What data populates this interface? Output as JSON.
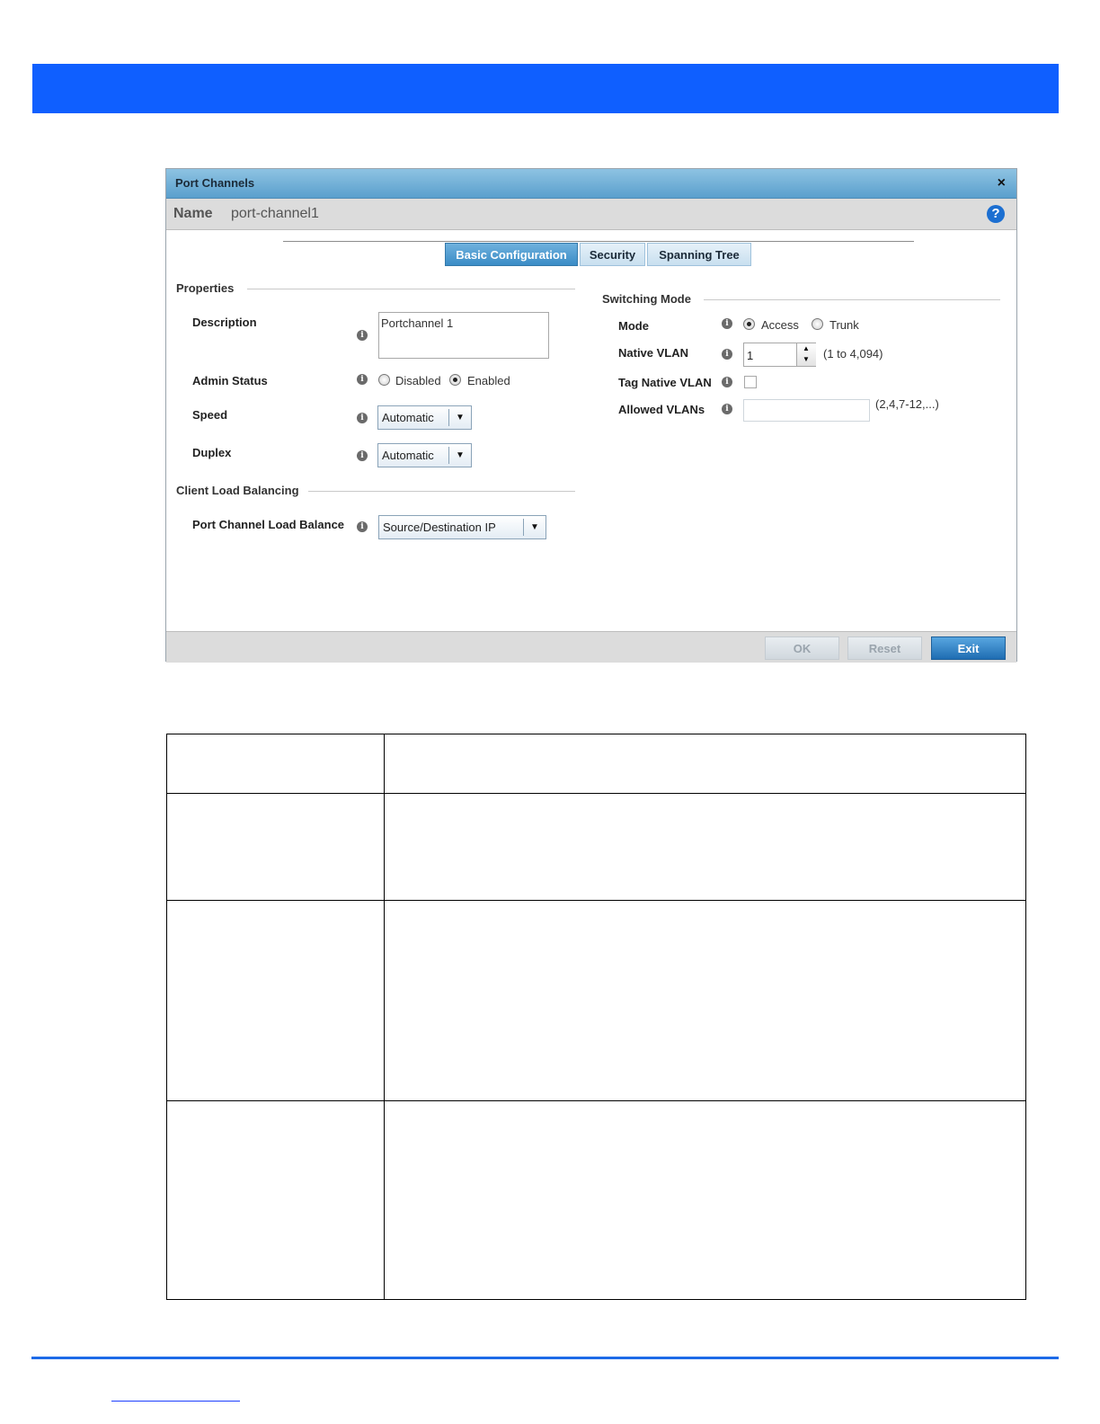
{
  "dialog": {
    "title": "Port Channels",
    "close_glyph": "×",
    "name_label": "Name",
    "name_value": "port-channel1",
    "help_glyph": "?",
    "tabs": [
      "Basic Configuration",
      "Security",
      "Spanning Tree"
    ],
    "active_tab": "Basic Configuration",
    "properties": {
      "section_title": "Properties",
      "description_label": "Description",
      "description_value": "Portchannel 1",
      "admin_status_label": "Admin Status",
      "admin_status_options": [
        "Disabled",
        "Enabled"
      ],
      "admin_status_selected": "Enabled",
      "speed_label": "Speed",
      "speed_value": "Automatic",
      "duplex_label": "Duplex",
      "duplex_value": "Automatic"
    },
    "client_load_balancing": {
      "section_title": "Client Load Balancing",
      "load_balance_label": "Port Channel Load Balance",
      "load_balance_value": "Source/Destination IP"
    },
    "switching_mode": {
      "section_title": "Switching Mode",
      "mode_label": "Mode",
      "mode_options": [
        "Access",
        "Trunk"
      ],
      "mode_selected": "Access",
      "native_vlan_label": "Native VLAN",
      "native_vlan_value": "1",
      "native_vlan_range": "(1 to 4,094)",
      "tag_native_vlan_label": "Tag Native VLAN",
      "tag_native_vlan_checked": false,
      "allowed_vlans_label": "Allowed VLANs",
      "allowed_vlans_value": "",
      "allowed_vlans_hint": "(2,4,7-12,...)"
    },
    "buttons": {
      "ok": "OK",
      "reset": "Reset",
      "exit": "Exit"
    }
  },
  "info_glyph": "i",
  "dropdown_glyph": "▼",
  "spinner_up_glyph": "▲",
  "spinner_down_glyph": "▼",
  "colors": {
    "banner": "#0f5fff",
    "accent": "#1c6fd1",
    "rule": "#1d6be8"
  }
}
